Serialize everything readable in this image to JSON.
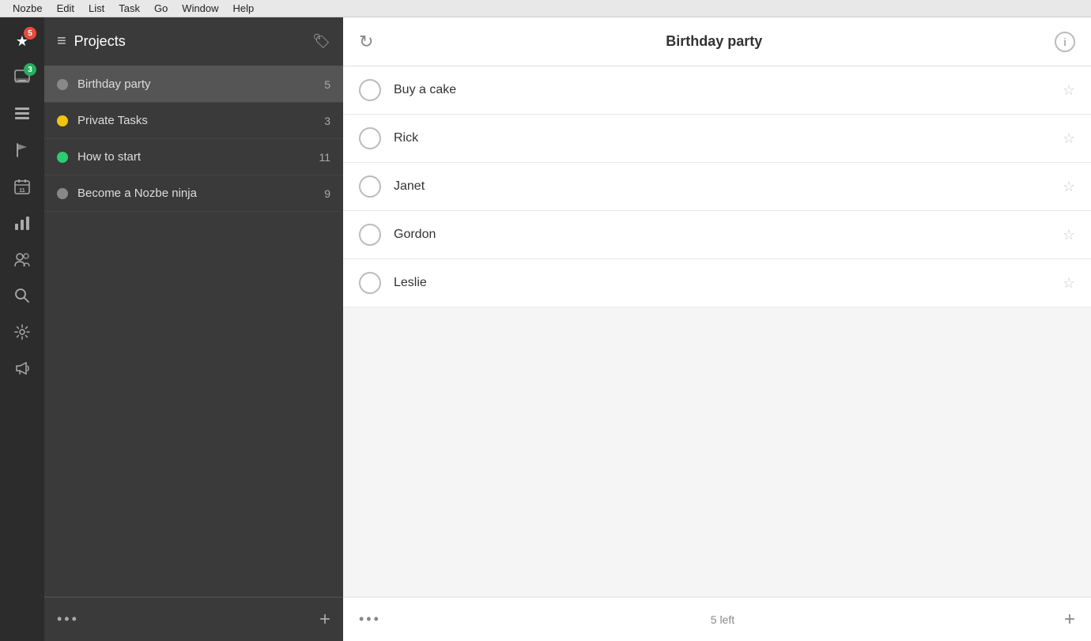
{
  "menubar": {
    "items": [
      "Nozbe",
      "Edit",
      "List",
      "Task",
      "Go",
      "Window",
      "Help"
    ]
  },
  "icon_sidebar": {
    "items": [
      {
        "name": "star-icon",
        "symbol": "★",
        "badge": "5",
        "badge_type": "red"
      },
      {
        "name": "inbox-icon",
        "symbol": "⊞",
        "badge": "3",
        "badge_type": "green"
      },
      {
        "name": "projects-icon",
        "symbol": "▤",
        "badge": null
      },
      {
        "name": "flag-icon",
        "symbol": "⚑",
        "badge": null
      },
      {
        "name": "calendar-icon",
        "symbol": "⬛",
        "label": "11",
        "badge": null
      },
      {
        "name": "chart-icon",
        "symbol": "▦",
        "badge": null
      },
      {
        "name": "team-icon",
        "symbol": "👥",
        "badge": null
      },
      {
        "name": "search-icon",
        "symbol": "🔍",
        "badge": null
      },
      {
        "name": "settings-icon",
        "symbol": "⚙",
        "badge": null
      },
      {
        "name": "megaphone-icon",
        "symbol": "📣",
        "badge": null
      }
    ]
  },
  "projects_sidebar": {
    "header": {
      "icon": "≡",
      "title": "Projects",
      "tag_icon": "🏷"
    },
    "projects": [
      {
        "name": "Birthday party",
        "dot_color": "#888",
        "count": "5",
        "active": true
      },
      {
        "name": "Private Tasks",
        "dot_color": "#f1c40f",
        "count": "3",
        "active": false
      },
      {
        "name": "How to start",
        "dot_color": "#2ecc71",
        "count": "11",
        "active": false
      },
      {
        "name": "Become a Nozbe ninja",
        "dot_color": "#888",
        "count": "9",
        "active": false
      }
    ],
    "footer": {
      "dots": "•••",
      "plus": "+"
    }
  },
  "content": {
    "header": {
      "sync_icon": "↻",
      "title": "Birthday party",
      "info_icon": "ℹ"
    },
    "tasks": [
      {
        "name": "Buy a cake",
        "starred": false
      },
      {
        "name": "Rick",
        "starred": false
      },
      {
        "name": "Janet",
        "starred": false
      },
      {
        "name": "Gordon",
        "starred": false
      },
      {
        "name": "Leslie",
        "starred": false
      }
    ],
    "footer": {
      "dots": "•••",
      "count": "5 left",
      "plus": "+"
    }
  },
  "colors": {
    "accent": "#2ecc71",
    "sidebar_bg": "#3a3a3a",
    "icon_sidebar_bg": "#2c2c2c",
    "active_item_bg": "#555555"
  }
}
